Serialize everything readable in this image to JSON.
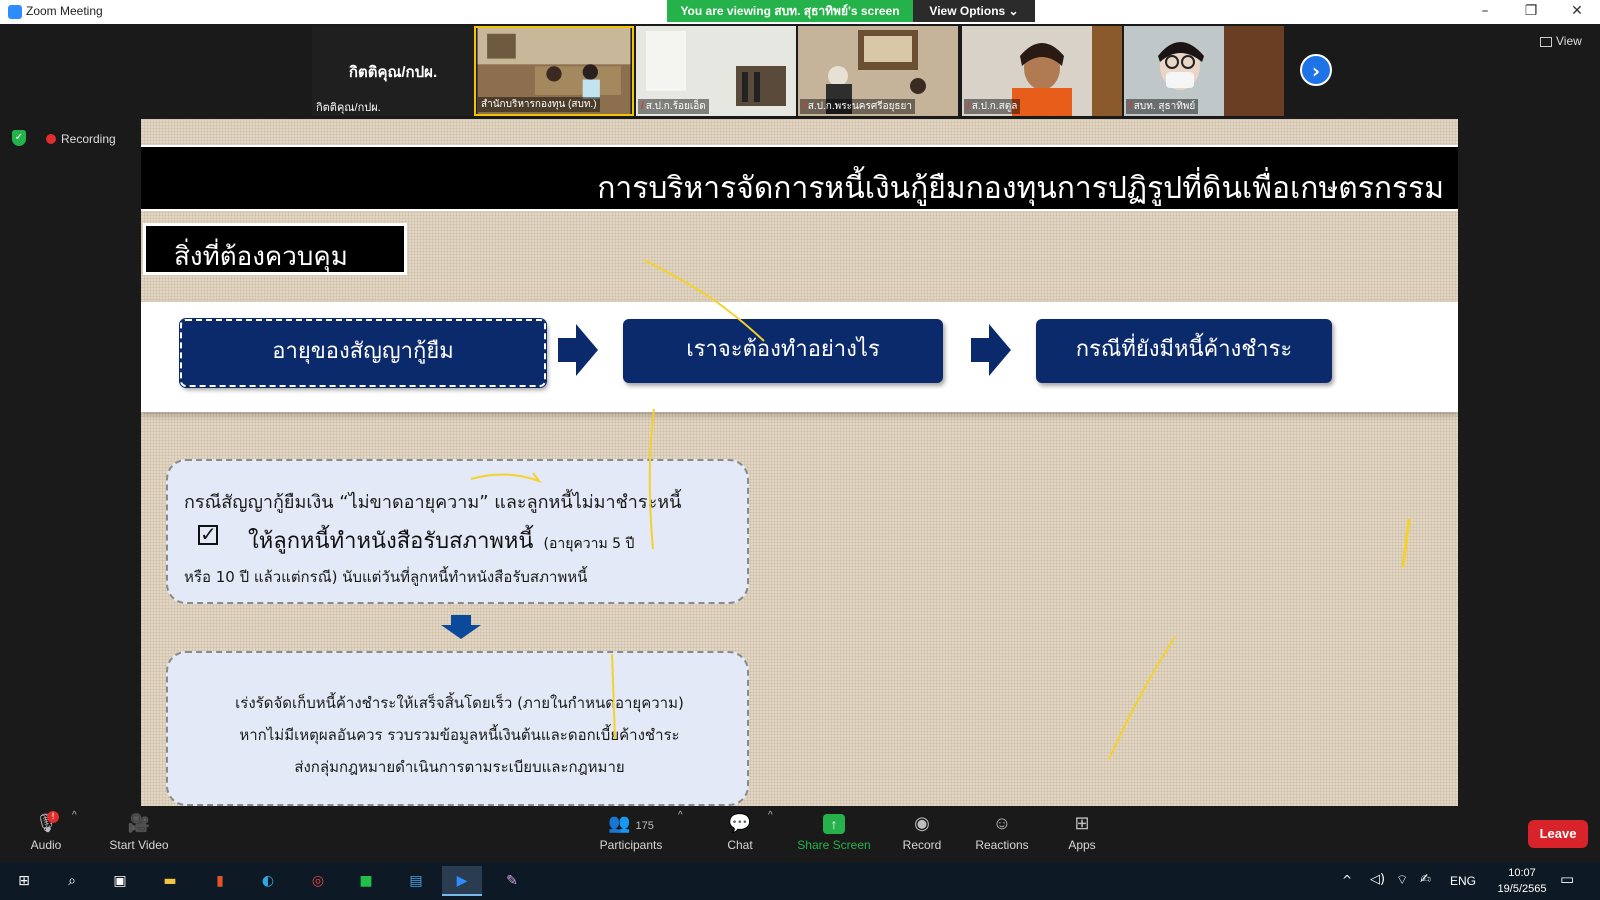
{
  "window": {
    "title": "Zoom Meeting"
  },
  "share_banner": {
    "text": "You are viewing สบท. สุธาทิพย์'s screen",
    "view_options": "View Options"
  },
  "host": {
    "name": "กิตติคุณ/กปผ.",
    "name_small": "กิตติคุณ/กปผ."
  },
  "participants": [
    {
      "name": "สำนักบริหารกองทุน (สบท.)",
      "muted": false
    },
    {
      "name": "ส.ป.ก.ร้อยเอ็ด",
      "muted": true
    },
    {
      "name": "ส.ป.ก.พระนครศรีอยุธยา",
      "muted": true
    },
    {
      "name": "ส.ป.ก.สตูล",
      "muted": true
    },
    {
      "name": "สบท. สุธาทิพย์",
      "muted": true
    }
  ],
  "view_label": "View",
  "recording_label": "Recording",
  "slide": {
    "title": "การบริหารจัดการหนี้เงินกู้ยืมกองทุนการปฏิรูปที่ดินเพื่อเกษตรกรรม",
    "section": "สิ่งที่ต้องควบคุม",
    "flow": [
      "อายุของสัญญากู้ยืม",
      "เราจะต้องทำอย่างไร",
      "กรณีที่ยังมีหนี้ค้างชำระ"
    ],
    "note1": {
      "line1": "กรณีสัญญากู้ยืมเงิน  “ไม่ขาดอายุความ”  และลูกหนี้ไม่มาชำระหนี้",
      "line2": "ให้ลูกหนี้ทำหนังสือรับสภาพหนี้",
      "line2_sub": "(อายุความ  5  ปี",
      "line3": "หรือ  10  ปี  แล้วแต่กรณี)  นับแต่วันที่ลูกหนี้ทำหนังสือรับสภาพหนี้"
    },
    "note2": [
      "เร่งรัดจัดเก็บหนี้ค้างชำระให้เสร็จสิ้นโดยเร็ว  (ภายในกำหนดอายุความ)",
      "หากไม่มีเหตุผลอันควร  รวบรวมข้อมูลหนี้เงินต้นและดอกเบี้ยค้างชำระ",
      "ส่งกลุ่มกฎหมายดำเนินการตามระเบียบและกฎหมาย"
    ]
  },
  "toolbar": {
    "audio": "Audio",
    "audio_badge": "!",
    "start_video": "Start Video",
    "participants": "Participants",
    "participants_count": "175",
    "chat": "Chat",
    "share_screen": "Share Screen",
    "record": "Record",
    "reactions": "Reactions",
    "apps": "Apps",
    "leave": "Leave"
  },
  "taskbar": {
    "lang": "ENG",
    "time": "10:07",
    "date": "19/5/2565"
  },
  "colors": {
    "navy": "#0b2a6b",
    "share_green": "#26b24b",
    "leave_red": "#d8232a",
    "highlight_yellow": "#f5c400"
  }
}
